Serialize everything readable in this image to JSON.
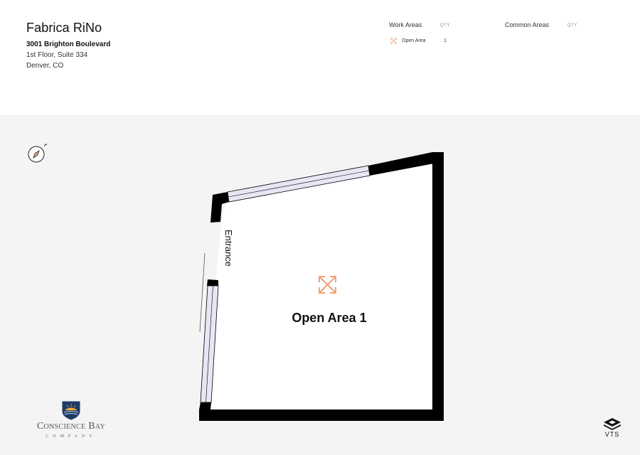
{
  "property": {
    "name": "Fabrica RiNo",
    "address_line1": "3001 Brighton Boulevard",
    "address_line2": "1st Floor, Suite 334",
    "address_line3": "Denver, CO"
  },
  "legend": {
    "work_areas": {
      "heading": "Work Areas",
      "qty_label": "QTY",
      "items": [
        {
          "label": "Open Area",
          "qty": "1",
          "icon": "expand-arrows-icon",
          "color": "#f0a278"
        }
      ]
    },
    "common_areas": {
      "heading": "Common Areas",
      "qty_label": "QTY"
    }
  },
  "floor_plan": {
    "room_label": "Open Area 1",
    "entrance_label": "Entrance",
    "room_icon": "expand-arrows-icon",
    "room_icon_color": "#f0a278",
    "wall_color": "#000000",
    "window_color": "#e6e6f5",
    "background_color": "#f4f4f4",
    "compass_icon": "compass-north-icon"
  },
  "branding": {
    "company_name": "Conscience Bay",
    "company_sub": "COMPANY",
    "vts_label": "VTS",
    "crest_icon": "sunrise-crest-icon",
    "vts_icon": "vts-logo-icon"
  }
}
